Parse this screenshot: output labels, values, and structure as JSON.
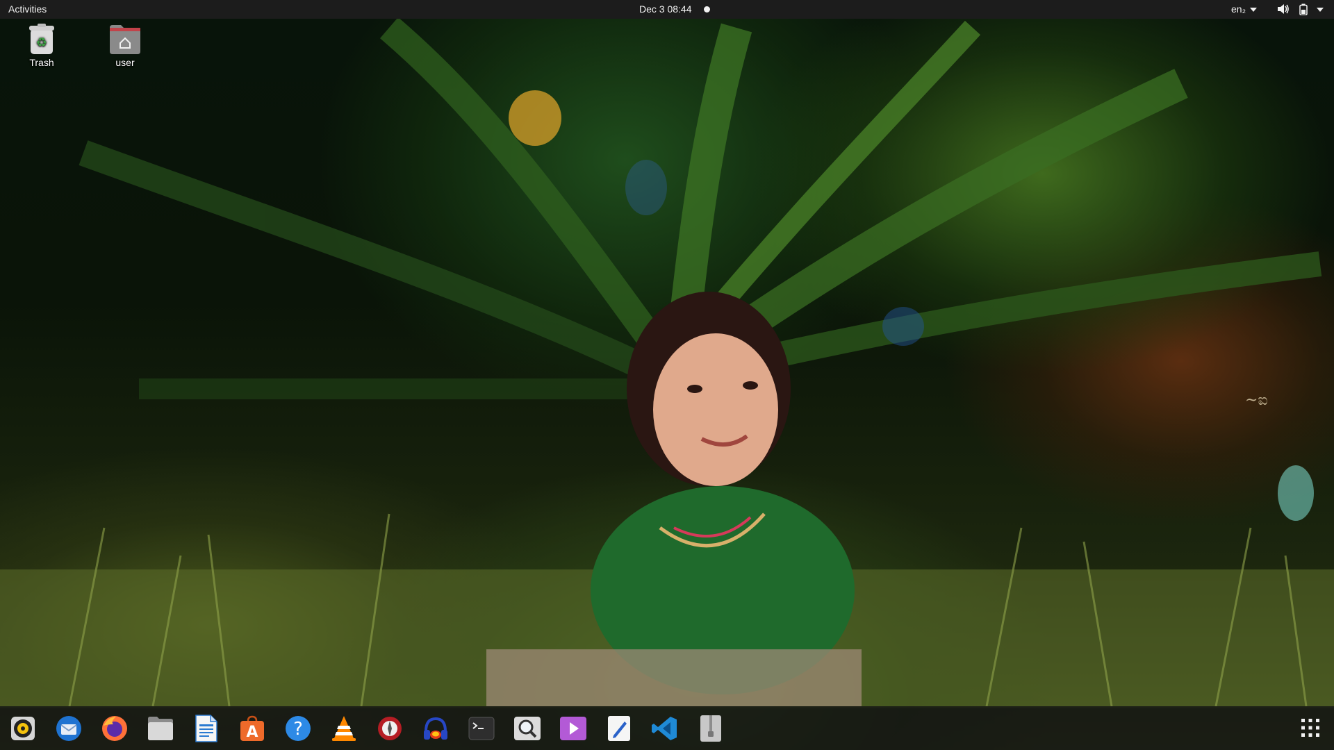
{
  "topbar": {
    "activities": "Activities",
    "clock": "Dec 3  08:44",
    "language": "en₂"
  },
  "desktop": {
    "icons": [
      {
        "label": "Trash",
        "icon": "trash-icon"
      },
      {
        "label": "user",
        "icon": "home-folder-icon"
      }
    ]
  },
  "dock": {
    "apps": [
      {
        "name": "rhythmbox",
        "icon": "rhythmbox-icon"
      },
      {
        "name": "thunderbird",
        "icon": "thunderbird-icon"
      },
      {
        "name": "firefox",
        "icon": "firefox-icon"
      },
      {
        "name": "files",
        "icon": "files-icon"
      },
      {
        "name": "libreoffice-writer",
        "icon": "writer-icon"
      },
      {
        "name": "ubuntu-software",
        "icon": "software-center-icon"
      },
      {
        "name": "help",
        "icon": "help-icon"
      },
      {
        "name": "vlc",
        "icon": "vlc-icon"
      },
      {
        "name": "gimp-like",
        "icon": "transmission-icon"
      },
      {
        "name": "audio-recorder",
        "icon": "headphones-icon"
      },
      {
        "name": "terminal",
        "icon": "terminal-icon"
      },
      {
        "name": "image-viewer",
        "icon": "magnifier-icon"
      },
      {
        "name": "video-player",
        "icon": "video-player-icon"
      },
      {
        "name": "text-editor",
        "icon": "text-editor-icon"
      },
      {
        "name": "vscode",
        "icon": "vscode-icon"
      },
      {
        "name": "archive-manager",
        "icon": "archive-icon"
      }
    ],
    "show_apps": "apps-grid-icon"
  },
  "colors": {
    "topbar": "#1c1c1c",
    "dock": "#141414",
    "text": "#f2f2f2"
  }
}
